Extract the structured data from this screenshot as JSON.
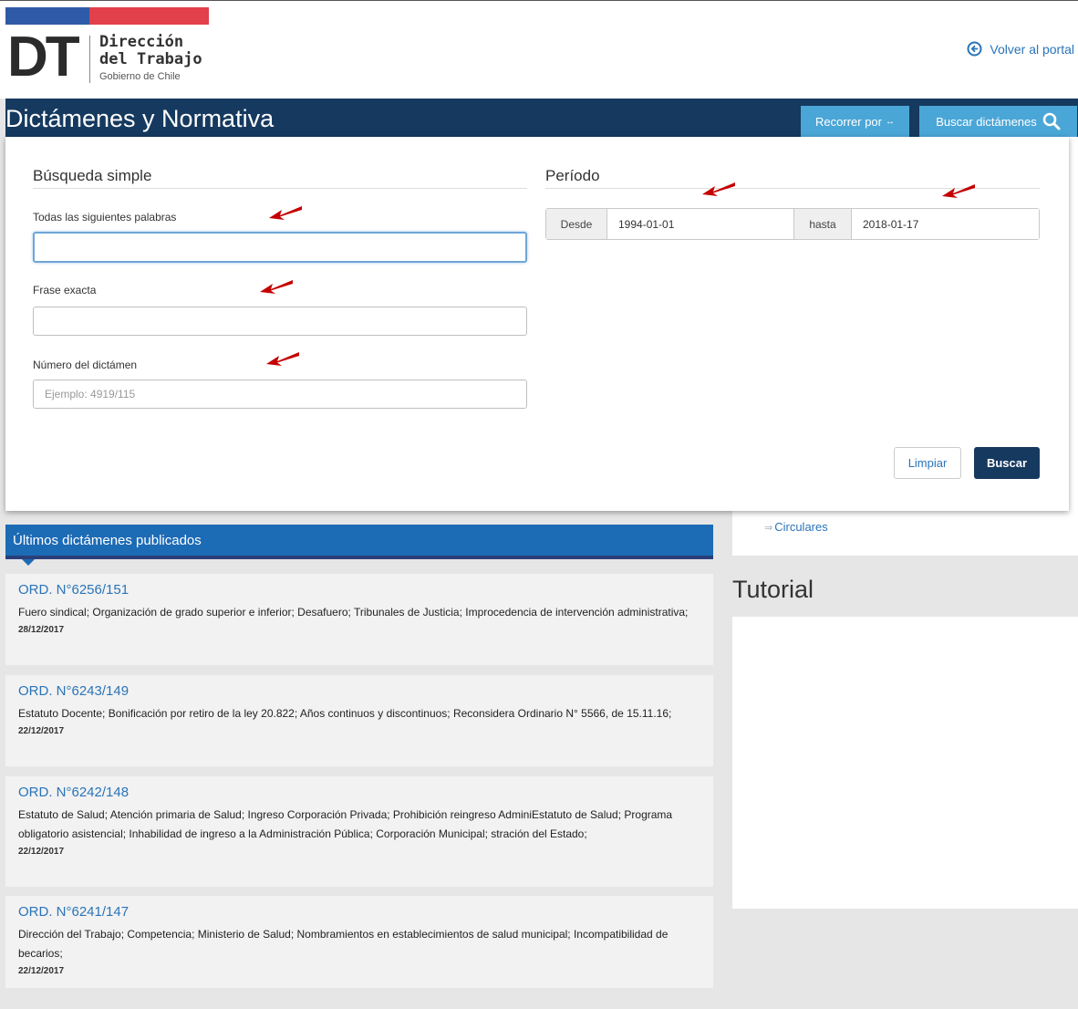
{
  "header": {
    "logo_mark": "DT",
    "logo_line1": "Dirección",
    "logo_line2": "del Trabajo",
    "logo_sub": "Gobierno de Chile",
    "back_link": "Volver al portal",
    "flag_colors": [
      "#2f5aa8",
      "#e2404a"
    ]
  },
  "titlebar": {
    "title": "Dictámenes y Normativa",
    "browse_button": "Recorrer por",
    "browse_icon": "double-arrow-icon",
    "search_button": "Buscar dictámenes",
    "search_icon": "search-icon"
  },
  "search": {
    "simple_title": "Búsqueda simple",
    "all_words_label": "Todas las siguientes palabras",
    "all_words_value": "",
    "exact_phrase_label": "Frase exacta",
    "exact_phrase_value": "",
    "number_label": "Número del dictámen",
    "number_placeholder": "Ejemplo: 4919/115",
    "period_title": "Período",
    "from_label": "Desde",
    "from_value": "1994-01-01",
    "to_label": "hasta",
    "to_value": "2018-01-17",
    "clear_button": "Limpiar",
    "submit_button": "Buscar"
  },
  "sidebar": {
    "link_circulares": "Circulares",
    "tutorial_title": "Tutorial"
  },
  "latest": {
    "heading": "Últimos dictámenes publicados",
    "items": [
      {
        "ord": "ORD. N°6256/151",
        "desc": "Fuero sindical; Organización de grado superior e inferior; Desafuero; Tribunales de Justicia; Improcedencia de intervención administrativa;",
        "date": "28/12/2017"
      },
      {
        "ord": "ORD. N°6243/149",
        "desc": "Estatuto Docente; Bonificación por retiro de la ley 20.822; Años continuos y discontinuos; Reconsidera Ordinario N° 5566, de 15.11.16;",
        "date": "22/12/2017"
      },
      {
        "ord": "ORD. N°6242/148",
        "desc": "Estatuto de Salud; Atención primaria de Salud; Ingreso Corporación Privada; Prohibición reingreso AdminiEstatuto de Salud; Programa obligatorio asistencial; Inhabilidad de ingreso a la Administración Pública; Corporación Municipal; stración del Estado;",
        "date": "22/12/2017"
      },
      {
        "ord": "ORD. N°6241/147",
        "desc": "Dirección del Trabajo; Competencia; Ministerio de Salud; Nombramientos en establecimientos de salud municipal; Incompatibilidad de becarios;",
        "date": "22/12/2017"
      }
    ]
  },
  "colors": {
    "navy": "#16395f",
    "light_blue": "#4aa6d6",
    "link_blue": "#2a74b8",
    "section_blue": "#1c6bb5",
    "annotation_red": "#c40000"
  }
}
